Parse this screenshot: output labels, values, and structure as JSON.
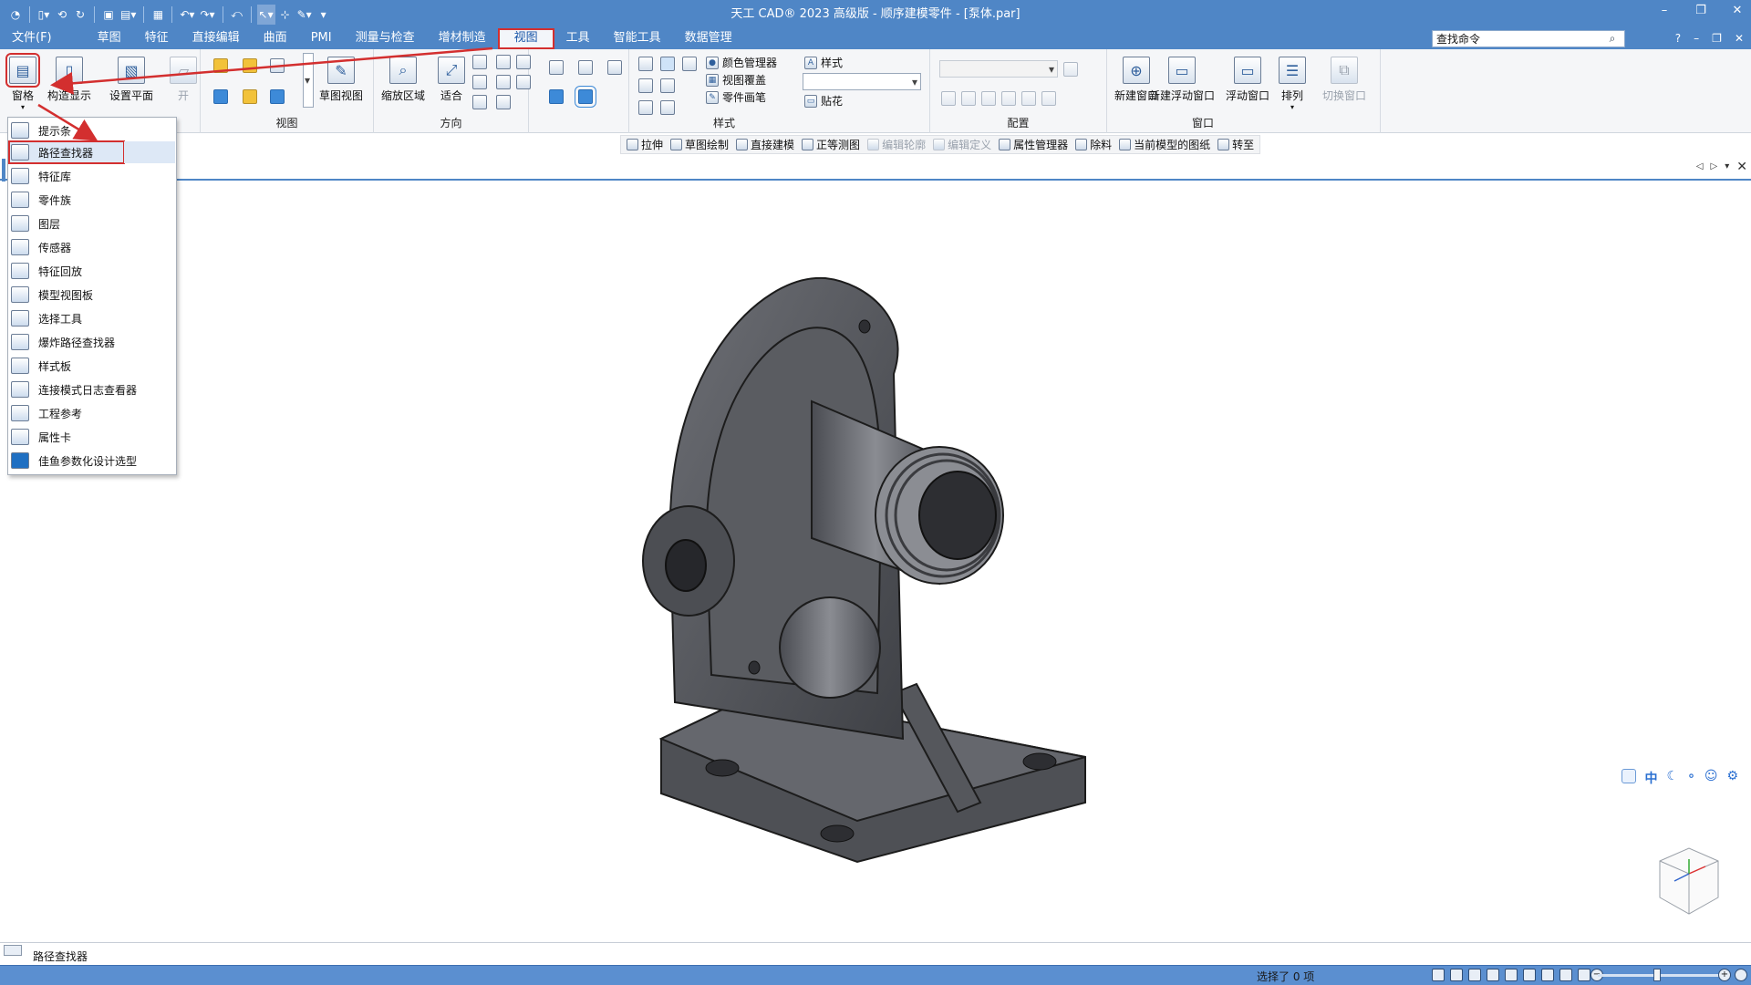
{
  "app": {
    "title": "天工 CAD® 2023 高级版 - 顺序建模零件 - [泵体.par]"
  },
  "menubar": {
    "tabs": [
      {
        "label": "文件(F)"
      },
      {
        "label": "草图"
      },
      {
        "label": "特征"
      },
      {
        "label": "直接编辑"
      },
      {
        "label": "曲面"
      },
      {
        "label": "PMI"
      },
      {
        "label": "测量与检查"
      },
      {
        "label": "增材制造"
      },
      {
        "label": "视图"
      },
      {
        "label": "工具"
      },
      {
        "label": "智能工具"
      },
      {
        "label": "数据管理"
      }
    ],
    "active_tab": "视图",
    "search_value": "查找命令"
  },
  "ribbon": {
    "groups": {
      "view": "视图",
      "orientation": "方向",
      "style": "样式",
      "config": "配置",
      "window": "窗口"
    },
    "buttons": {
      "pane": "窗格",
      "build_display": "构造显示",
      "set_plane": "设置平面",
      "open": "开",
      "sketch_view": "草图视图",
      "zoom_area": "缩放区域",
      "fit": "适合",
      "color_manager": "颜色管理器",
      "view_overlay": "视图覆盖",
      "part_brush": "零件画笔",
      "style_label": "样式",
      "decal": "贴花",
      "new_window": "新建窗口",
      "new_float_window": "新建浮动窗口",
      "float_window": "浮动窗口",
      "arrange": "排列",
      "switch_window": "切换窗口"
    }
  },
  "commandbar": {
    "items": [
      {
        "label": "拉伸",
        "enabled": true
      },
      {
        "label": "草图绘制",
        "enabled": true
      },
      {
        "label": "直接建模",
        "enabled": true
      },
      {
        "label": "正等测图",
        "enabled": true
      },
      {
        "label": "编辑轮廓",
        "enabled": false
      },
      {
        "label": "编辑定义",
        "enabled": false
      },
      {
        "label": "属性管理器",
        "enabled": true
      },
      {
        "label": "除料",
        "enabled": true
      },
      {
        "label": "当前模型的图纸",
        "enabled": true
      },
      {
        "label": "转至",
        "enabled": true
      }
    ]
  },
  "pane_menu": {
    "items": [
      {
        "label": "提示条"
      },
      {
        "label": "路径查找器"
      },
      {
        "label": "特征库"
      },
      {
        "label": "零件族"
      },
      {
        "label": "图层"
      },
      {
        "label": "传感器"
      },
      {
        "label": "特征回放"
      },
      {
        "label": "模型视图板"
      },
      {
        "label": "选择工具"
      },
      {
        "label": "爆炸路径查找器"
      },
      {
        "label": "样式板"
      },
      {
        "label": "连接模式日志查看器"
      },
      {
        "label": "工程参考"
      },
      {
        "label": "属性卡"
      },
      {
        "label": "佳鱼参数化设计选型"
      }
    ],
    "selected_index": 1
  },
  "viewtools": {
    "center_label": "中"
  },
  "commandline": {
    "text": "路径查找器"
  },
  "status": {
    "text": "选择了 0 项",
    "zoom_level": 0.47
  },
  "colors": {
    "titlebar": "#4f86c6",
    "statusbar": "#5b8fd0",
    "highlight": "#d32f2f",
    "part_body": "#5a5c61"
  }
}
